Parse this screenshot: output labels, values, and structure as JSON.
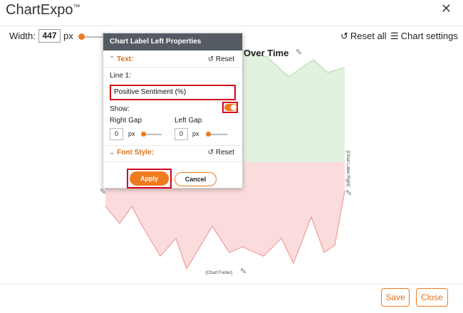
{
  "app": {
    "title": "ChartExpo",
    "trademark": "™",
    "close_icon": "✕"
  },
  "toolbar": {
    "width_label": "Width:",
    "width_value": "447",
    "width_unit": "px",
    "reset_all_label": "Reset all",
    "chart_settings_label": "Chart settings",
    "reset_icon": "reset-icon",
    "settings_icon": "sliders-icon"
  },
  "chart": {
    "title_partial": "Over Time",
    "label_right": "[Chart Label Right]",
    "footer_label": "[Chart Footer]",
    "positive_color": "#e3f1df",
    "positive_line": "#b9dcb1",
    "negative_color": "#fbdcdc",
    "negative_line": "#f29b9b"
  },
  "panel": {
    "header": "Chart Label Left Properties",
    "text_section": "Text:",
    "reset_label": "Reset",
    "line1_label": "Line 1:",
    "line1_value": "Positive Sentiment (%)",
    "show_label": "Show:",
    "show_on": true,
    "right_gap_label": "Right Gap",
    "right_gap_value": "0",
    "left_gap_label": "Left Gap",
    "left_gap_value": "0",
    "gap_unit": "px",
    "font_style_section": "Font Style:",
    "font_reset_label": "Reset",
    "apply_label": "Apply",
    "cancel_label": "Cancel"
  },
  "footer": {
    "save_label": "Save",
    "close_label": "Close"
  },
  "colors": {
    "accent": "#f07b1f",
    "highlight_border": "#d1001c",
    "panel_header": "#555b62"
  }
}
